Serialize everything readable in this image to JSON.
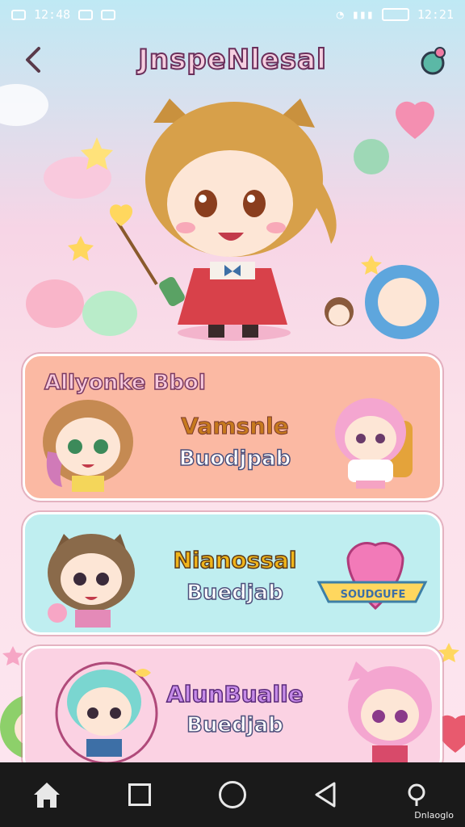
{
  "status_bar": {
    "time_left": "12:48",
    "time_right": "12:21"
  },
  "header": {
    "title": "JnspeNlesal"
  },
  "cards": [
    {
      "heading": "Allyonke Bbol",
      "line1": "Vamsnle",
      "line2": "Buodjpab"
    },
    {
      "line1": "Nianossal",
      "line2": "Buedjab",
      "badge": "SOUDGUFE"
    },
    {
      "line1": "AlunBualle",
      "line2": "Buedjab"
    }
  ],
  "nav": {
    "label": "Dnlaoglo"
  },
  "colors": {
    "sky": "#bfe9f4",
    "pink": "#f7d5e6",
    "card1": "#fbb9a3",
    "card2": "#bfeef0",
    "card3": "#fbd2e3"
  },
  "icons": [
    "back-arrow-icon",
    "profile-icon",
    "home-icon",
    "recent-apps-icon",
    "circle-home-icon",
    "back-triangle-icon",
    "search-icon"
  ]
}
